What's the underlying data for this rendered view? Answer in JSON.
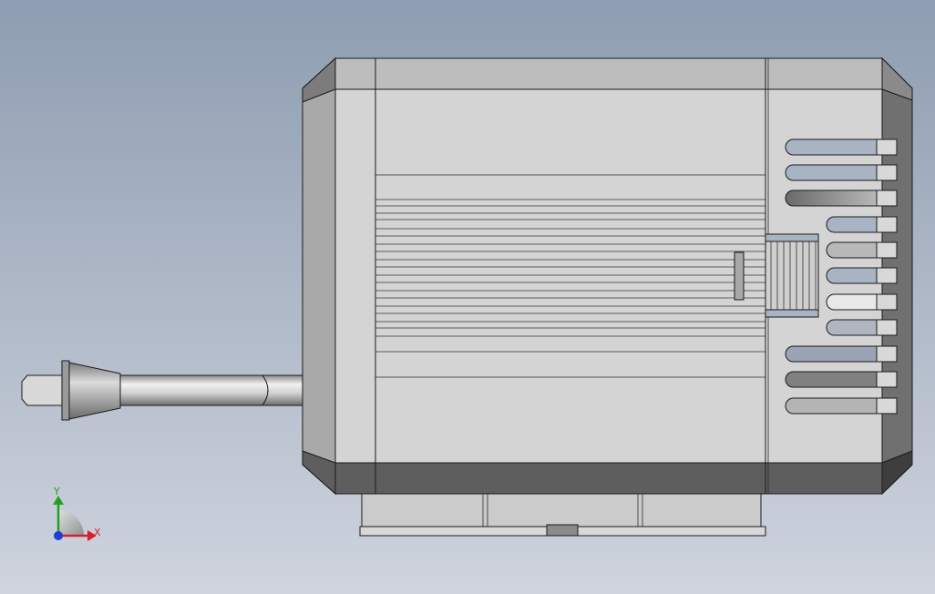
{
  "viewport": {
    "background_top": "#8e9db1",
    "background_bottom": "#cfd4de"
  },
  "triad": {
    "y_label": "Y",
    "x_label": "X",
    "y_color": "#1fa31f",
    "x_color": "#d8202a",
    "z_color": "#1f3fd6"
  },
  "motor": {
    "body_light": "#d4d4d4",
    "body_mid": "#bdbdbd",
    "body_dark": "#5e5e5e",
    "cap_side": "#9a9a9a",
    "shaft_color": "#c8c8c8"
  }
}
